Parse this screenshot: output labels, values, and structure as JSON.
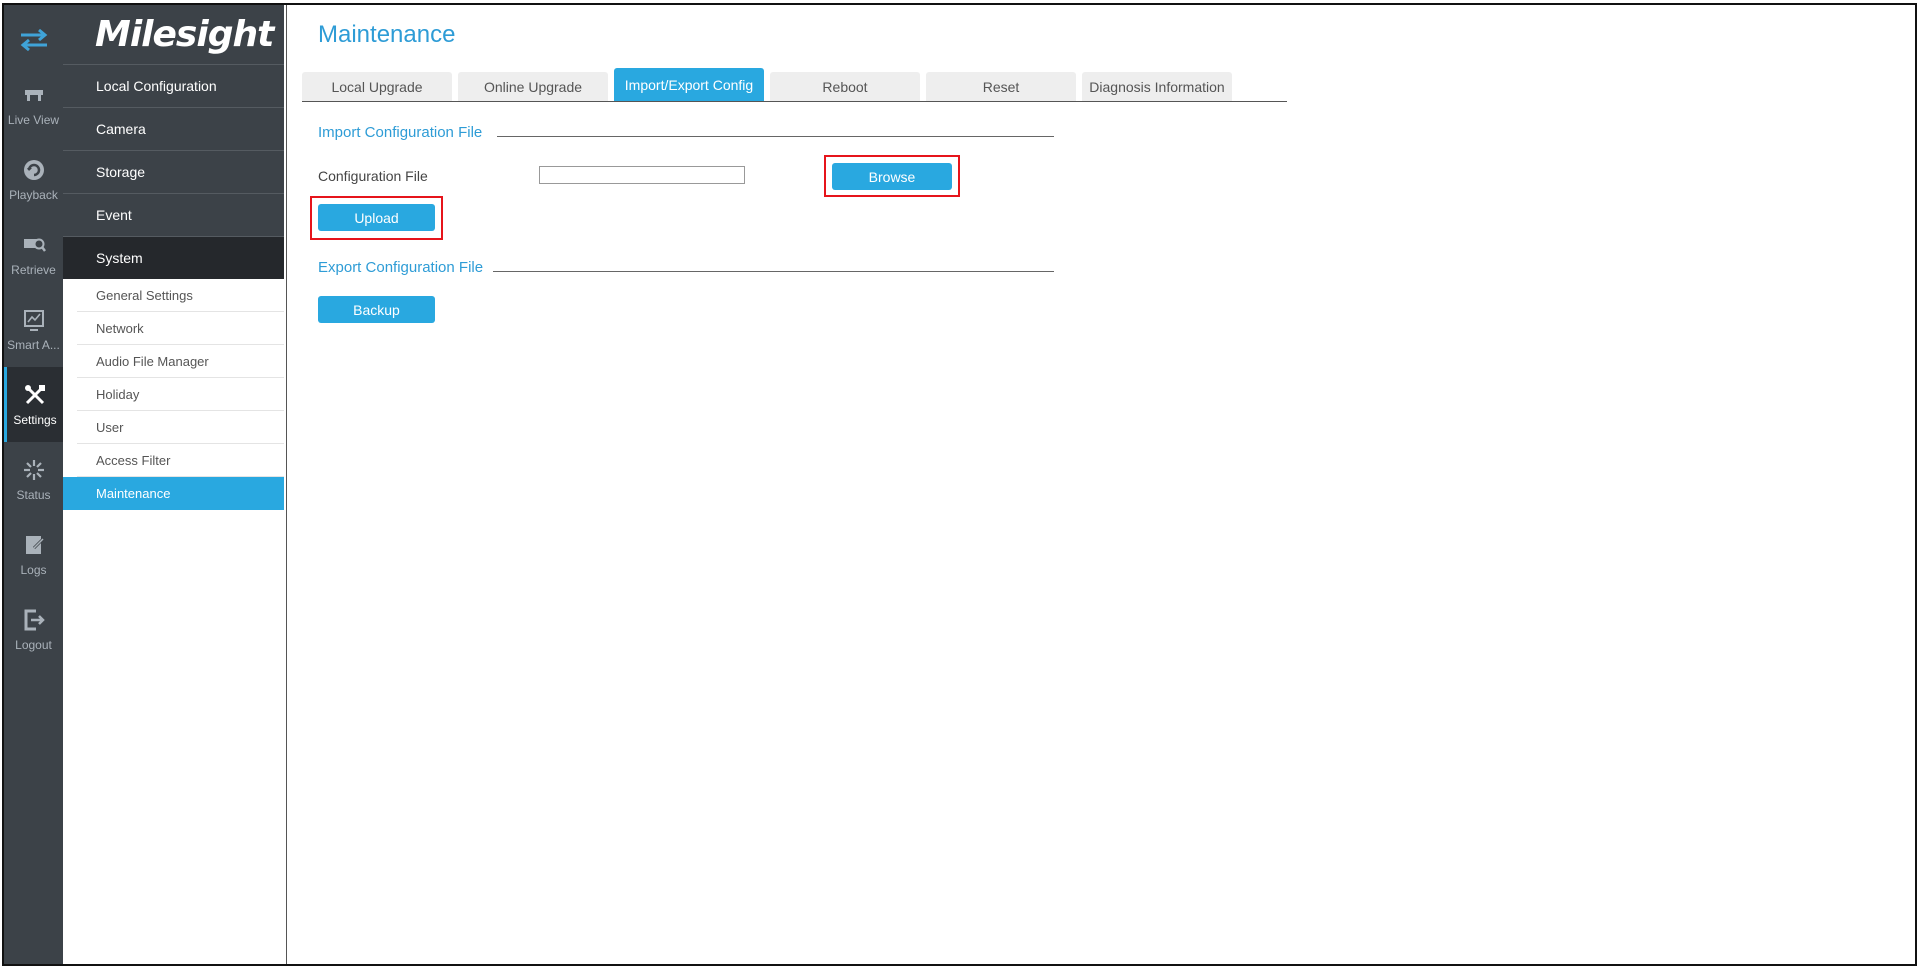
{
  "rail": {
    "items": [
      {
        "label": "Live View",
        "icon": "live-view-icon"
      },
      {
        "label": "Playback",
        "icon": "playback-icon"
      },
      {
        "label": "Retrieve",
        "icon": "retrieve-icon"
      },
      {
        "label": "Smart A...",
        "icon": "smart-analytics-icon"
      },
      {
        "label": "Settings",
        "icon": "settings-icon"
      },
      {
        "label": "Status",
        "icon": "status-icon"
      },
      {
        "label": "Logs",
        "icon": "logs-icon"
      },
      {
        "label": "Logout",
        "icon": "logout-icon"
      }
    ],
    "active": "Settings"
  },
  "brand": {
    "logo_text": "Milesight"
  },
  "menu": {
    "main": [
      "Local Configuration",
      "Camera",
      "Storage",
      "Event",
      "System"
    ],
    "sub": [
      "General Settings",
      "Network",
      "Audio File Manager",
      "Holiday",
      "User",
      "Access Filter",
      "Maintenance"
    ],
    "active_main": "System",
    "active_sub": "Maintenance"
  },
  "page": {
    "title": "Maintenance"
  },
  "tabs": [
    "Local Upgrade",
    "Online Upgrade",
    "Import/Export Config",
    "Reboot",
    "Reset",
    "Diagnosis Information"
  ],
  "active_tab": "Import/Export Config",
  "import": {
    "section_title": "Import Configuration File",
    "field_label": "Configuration File",
    "field_value": "",
    "browse_label": "Browse",
    "upload_label": "Upload"
  },
  "export": {
    "section_title": "Export Configuration File",
    "backup_label": "Backup"
  },
  "colors": {
    "accent": "#29a8e0",
    "title": "#2e9cd6",
    "sidebar": "#3c4248",
    "highlight": "#e6141b"
  }
}
